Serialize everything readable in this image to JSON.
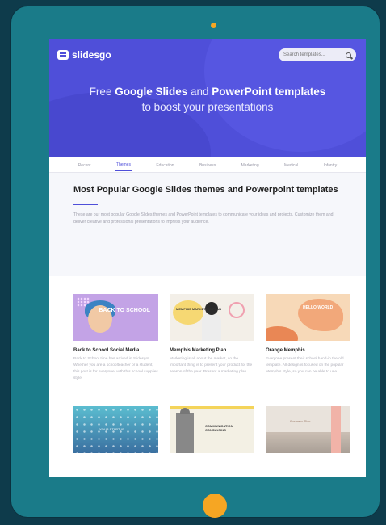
{
  "colors": {
    "background": "#0e3b4b",
    "tablet": "#1a7b89",
    "accent": "#f6a623",
    "hero": "#4f4fd9"
  },
  "header": {
    "logo": "slidesgo",
    "search_placeholder": "Search templates..."
  },
  "hero": {
    "line1_prefix": "Free ",
    "line1_bold1": "Google Slides",
    "line1_mid": " and ",
    "line1_bold2": "PowerPoint templates",
    "line2": "to boost your presentations"
  },
  "tabs": [
    "Recent",
    "Themes",
    "Education",
    "Business",
    "Marketing",
    "Medical",
    "Infantry"
  ],
  "active_tab": 1,
  "intro": {
    "title": "Most Popular Google Slides themes and Powerpoint templates",
    "text": "These are our most popular Google Slides themes and PowerPoint templates to communicate your ideas and projects. Customize them and deliver creative and professional presentations to impress your audience."
  },
  "cards": [
    {
      "title": "Back to School Social Media",
      "thumb_label": "BACK TO SCHOOL",
      "text": "Back to School time has arrived in Slidesgo! Whether you are a schoolteacher or a student, this post is for everyone, with this school supplies style."
    },
    {
      "title": "Memphis Marketing Plan",
      "thumb_label": "MEMPHIS MARKETING PLAN",
      "text": "Marketing is all about the market, so the important thing is to present your product for the season of the year. Present a marketing plan..."
    },
    {
      "title": "Orange Memphis",
      "thumb_label": "HELLO WORLD",
      "text": "Everyone present their school hand-in the old template. All design is focused on the popular Memphis style, so you can be able to use..."
    }
  ],
  "cards_row2": [
    {
      "thumb_label": "YOUR STARTUP"
    },
    {
      "thumb_label": "COMMUNICATION CONSULTING"
    },
    {
      "thumb_label": "Business Plan"
    }
  ]
}
